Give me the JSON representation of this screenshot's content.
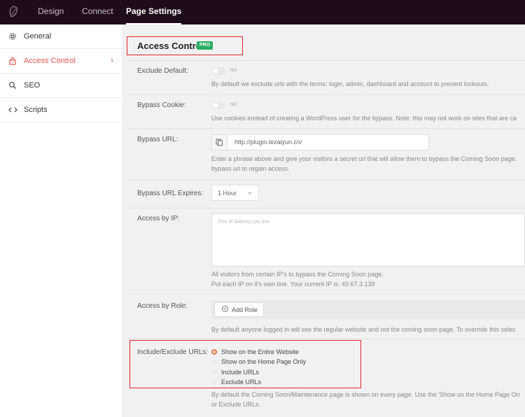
{
  "topbar": {
    "tabs": [
      {
        "label": "Design"
      },
      {
        "label": "Connect"
      },
      {
        "label": "Page Settings"
      }
    ]
  },
  "sidebar": {
    "items": [
      {
        "label": "General",
        "icon": "gear-icon"
      },
      {
        "label": "Access Control",
        "icon": "lock-icon"
      },
      {
        "label": "SEO",
        "icon": "search-icon"
      },
      {
        "label": "Scripts",
        "icon": "code-icon"
      }
    ]
  },
  "panel": {
    "title": "Access Control",
    "badge": "PRO"
  },
  "fields": {
    "exclude_default": {
      "label": "Exclude Default:",
      "toggle_text": "NO",
      "help": "By default we exclude urls with the terms: login, admin, dashboard and account to prevent lockouts."
    },
    "bypass_cookie": {
      "label": "Bypass Cookie:",
      "toggle_text": "NO",
      "help": "Use cookies instead of creating a WordPress user for the bypass. Note: this may not work on sites that are ca"
    },
    "bypass_url": {
      "label": "Bypass URL:",
      "value": "http://plugin.lezaiyun.cn/",
      "help_line1": "Enter a phrase above and give your visitors a secret url that will allow them to bypass the Coming Soon page.",
      "help_line2": "bypass url to regain access."
    },
    "bypass_expires": {
      "label": "Bypass URL Expires:",
      "value": "1 Hour"
    },
    "access_ip": {
      "label": "Access by IP:",
      "placeholder": "One IP Address per line",
      "help_line1": "All visitors from certain IP's to bypass the Coming Soon page.",
      "help_line2": "Put each IP on it's own line. Your current IP is: 49.67.3.139"
    },
    "access_role": {
      "label": "Access by Role:",
      "button": "Add Role",
      "help": "By default anyone logged in will see the regular website and not the coming soon page. To override this selec"
    },
    "include_exclude": {
      "label": "Include/Exclude URLs:",
      "options": [
        {
          "label": "Show on the Entire Website",
          "selected": true
        },
        {
          "label": "Show on the Home Page Only",
          "selected": false
        },
        {
          "label": "Include URLs",
          "selected": false
        },
        {
          "label": "Exclude URLs",
          "selected": false
        }
      ],
      "help_line1": "By default the Coming Soon/Maintenance page is shown on every page. Use the 'Show on the Home Page On",
      "help_line2": "or Exclude URLs."
    }
  },
  "colors": {
    "topbar": "#1e0b1b",
    "accent": "#e2574c",
    "pro": "#27ae60",
    "highlight": "#e0272f"
  }
}
